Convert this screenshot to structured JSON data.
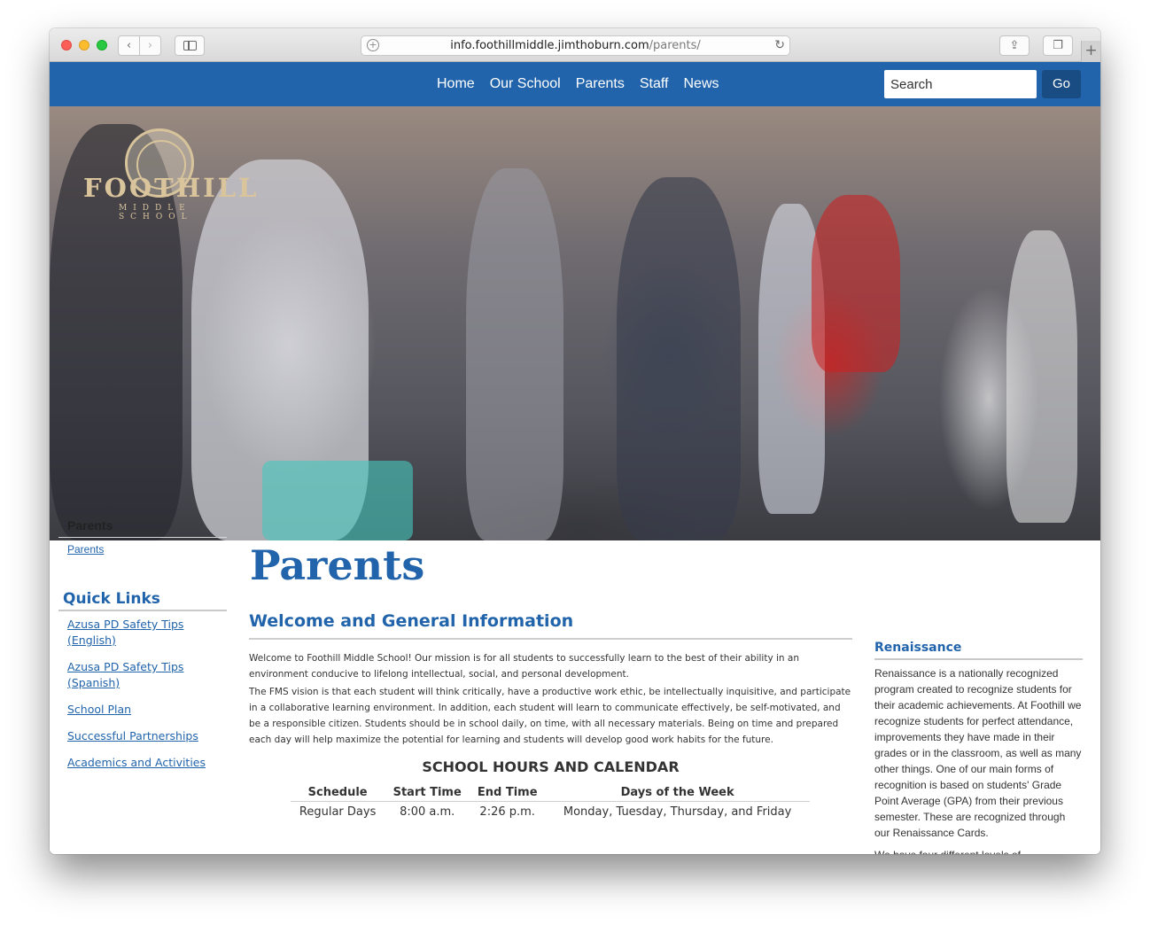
{
  "browser": {
    "url_domain": "info.foothillmiddle.jimthoburn.com",
    "url_path": "/parents/",
    "new_tab_symbol": "+",
    "back_symbol": "‹",
    "forward_symbol": "›"
  },
  "site_nav": {
    "links": [
      "Home",
      "Our School",
      "Parents",
      "Staff",
      "News"
    ],
    "search_placeholder": "Search",
    "search_button": "Go"
  },
  "logo": {
    "name": "FOOTHILL",
    "subtitle": "MIDDLE SCHOOL"
  },
  "sidebar": {
    "heading": "Parents",
    "link": "Parents",
    "quick_links_heading": "Quick Links",
    "quick_links": [
      "Azusa PD Safety Tips (English)",
      "Azusa PD Safety Tips (Spanish)",
      "School Plan",
      "Successful Partnerships",
      "Academics and Activities"
    ]
  },
  "main": {
    "title": "Parents",
    "section_title": "Welcome and General Information",
    "paragraphs": [
      "Welcome to Foothill Middle School!  Our mission is for all students to successfully learn to the best of their ability in an environment conducive to lifelong intellectual, social, and personal development.",
      "The FMS vision is that each student will think critically, have a productive work ethic, be intellectually inquisitive, and participate in a collaborative learning environment.  In addition, each student will learn to communicate effectively, be self-motivated, and be a responsible citizen.  Students should be in school daily, on time, with all necessary materials.  Being on time and prepared each day will help maximize the potential for learning and students will develop good work habits for the future."
    ],
    "hours_title": "SCHOOL HOURS AND CALENDAR",
    "hours_table": {
      "headers": [
        "Schedule",
        "Start Time",
        "End Time",
        "Days of the Week"
      ],
      "rows": [
        [
          "Regular Days",
          "8:00 a.m.",
          "2:26 p.m.",
          "Monday, Tuesday, Thursday, and Friday"
        ]
      ]
    }
  },
  "right_sidebar": {
    "heading": "Renaissance",
    "paragraphs": [
      "Renaissance is a nationally recognized program created to recognize students for their academic achievements.  At Foothill we recognize students for perfect attendance, improvements they have made in their grades or in the classroom, as well as many other things.  One of our main forms of recognition is based on students' Grade Point Average (GPA) from their previous semester.  These are recognized through our Renaissance Cards.",
      "We have four different levels of"
    ]
  },
  "colors": {
    "brand_blue": "#2164ab",
    "go_button": "#1a4c84",
    "logo_gold": "#d9c49c"
  },
  "icons": [
    "share-icon",
    "tabs-icon",
    "sidebar-icon",
    "reload-icon",
    "add-icon"
  ]
}
